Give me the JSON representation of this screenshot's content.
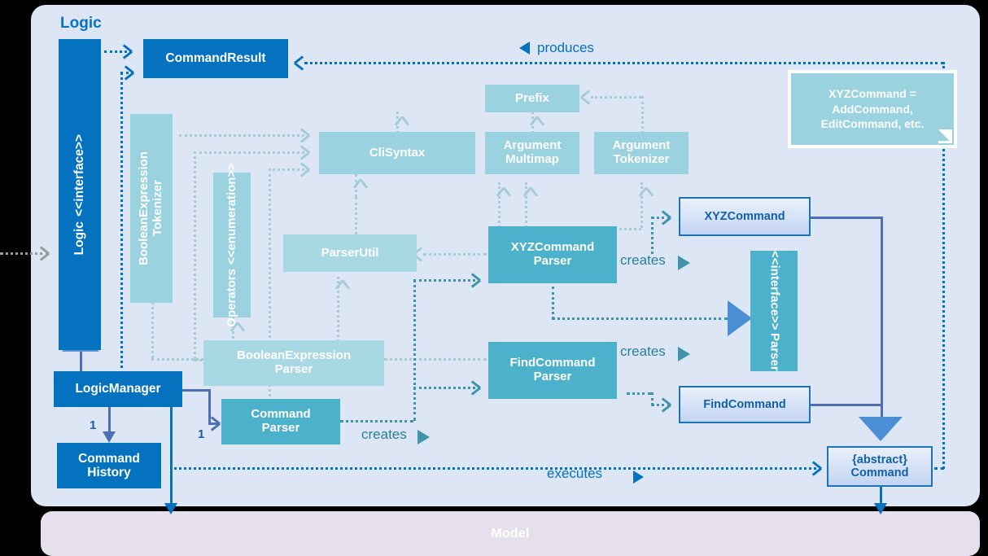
{
  "packages": {
    "logic": {
      "label": "Logic"
    },
    "model": {
      "label": "Model"
    }
  },
  "note": {
    "text": "XYZCommand = AddCommand, EditCommand, etc."
  },
  "classes": {
    "logic_interface": {
      "stereotype": "<<interface>>",
      "name": "Logic"
    },
    "command_result": {
      "name": "CommandResult"
    },
    "logic_manager": {
      "name": "LogicManager"
    },
    "command_history": {
      "name": "Command History"
    },
    "boolean_expression_tokenizer": {
      "name": "BooleanExpression Tokenizer"
    },
    "operators": {
      "stereotype": "<<enumeration>>",
      "name": "Operators"
    },
    "cli_syntax": {
      "name": "CliSyntax"
    },
    "prefix": {
      "name": "Prefix"
    },
    "argument_multimap": {
      "name": "Argument Multimap"
    },
    "argument_tokenizer": {
      "name": "Argument Tokenizer"
    },
    "parser_util": {
      "name": "ParserUtil"
    },
    "boolean_expression_parser": {
      "name": "BooleanExpression Parser"
    },
    "command_parser": {
      "name": "Command Parser"
    },
    "xyz_command_parser": {
      "name": "XYZCommand Parser"
    },
    "find_command_parser": {
      "name": "FindCommand Parser"
    },
    "xyz_command": {
      "name": "XYZCommand"
    },
    "find_command": {
      "name": "FindCommand"
    },
    "parser_interface": {
      "stereotype": "<<interface>>",
      "name": "Parser"
    },
    "command_abstract": {
      "modifier": "{abstract}",
      "name": "Command"
    }
  },
  "relationship_labels": {
    "produces": "produces",
    "executes": "executes",
    "creates_1": "creates",
    "creates_2": "creates",
    "creates_3": "creates"
  },
  "multiplicities": {
    "history": "1",
    "parser": "1"
  },
  "colors": {
    "package_bg": "#dce6f4",
    "model_bg": "#e5e0ec",
    "dark_blue": "#0572c0",
    "mid_teal": "#4cb1cb",
    "light_teal": "#9ad2e0",
    "command_border": "#1c74bb",
    "canvas": "#000000"
  }
}
